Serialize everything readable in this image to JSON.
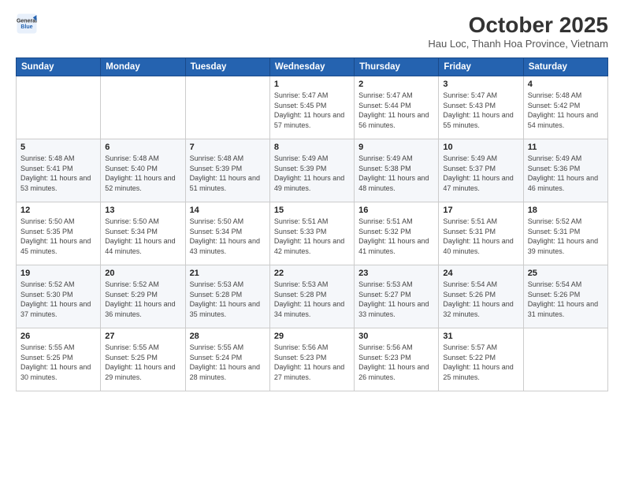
{
  "logo": {
    "line1": "General",
    "line2": "Blue"
  },
  "title": "October 2025",
  "subtitle": "Hau Loc, Thanh Hoa Province, Vietnam",
  "days_of_week": [
    "Sunday",
    "Monday",
    "Tuesday",
    "Wednesday",
    "Thursday",
    "Friday",
    "Saturday"
  ],
  "weeks": [
    [
      {
        "num": "",
        "info": ""
      },
      {
        "num": "",
        "info": ""
      },
      {
        "num": "",
        "info": ""
      },
      {
        "num": "1",
        "info": "Sunrise: 5:47 AM\nSunset: 5:45 PM\nDaylight: 11 hours and 57 minutes."
      },
      {
        "num": "2",
        "info": "Sunrise: 5:47 AM\nSunset: 5:44 PM\nDaylight: 11 hours and 56 minutes."
      },
      {
        "num": "3",
        "info": "Sunrise: 5:47 AM\nSunset: 5:43 PM\nDaylight: 11 hours and 55 minutes."
      },
      {
        "num": "4",
        "info": "Sunrise: 5:48 AM\nSunset: 5:42 PM\nDaylight: 11 hours and 54 minutes."
      }
    ],
    [
      {
        "num": "5",
        "info": "Sunrise: 5:48 AM\nSunset: 5:41 PM\nDaylight: 11 hours and 53 minutes."
      },
      {
        "num": "6",
        "info": "Sunrise: 5:48 AM\nSunset: 5:40 PM\nDaylight: 11 hours and 52 minutes."
      },
      {
        "num": "7",
        "info": "Sunrise: 5:48 AM\nSunset: 5:39 PM\nDaylight: 11 hours and 51 minutes."
      },
      {
        "num": "8",
        "info": "Sunrise: 5:49 AM\nSunset: 5:39 PM\nDaylight: 11 hours and 49 minutes."
      },
      {
        "num": "9",
        "info": "Sunrise: 5:49 AM\nSunset: 5:38 PM\nDaylight: 11 hours and 48 minutes."
      },
      {
        "num": "10",
        "info": "Sunrise: 5:49 AM\nSunset: 5:37 PM\nDaylight: 11 hours and 47 minutes."
      },
      {
        "num": "11",
        "info": "Sunrise: 5:49 AM\nSunset: 5:36 PM\nDaylight: 11 hours and 46 minutes."
      }
    ],
    [
      {
        "num": "12",
        "info": "Sunrise: 5:50 AM\nSunset: 5:35 PM\nDaylight: 11 hours and 45 minutes."
      },
      {
        "num": "13",
        "info": "Sunrise: 5:50 AM\nSunset: 5:34 PM\nDaylight: 11 hours and 44 minutes."
      },
      {
        "num": "14",
        "info": "Sunrise: 5:50 AM\nSunset: 5:34 PM\nDaylight: 11 hours and 43 minutes."
      },
      {
        "num": "15",
        "info": "Sunrise: 5:51 AM\nSunset: 5:33 PM\nDaylight: 11 hours and 42 minutes."
      },
      {
        "num": "16",
        "info": "Sunrise: 5:51 AM\nSunset: 5:32 PM\nDaylight: 11 hours and 41 minutes."
      },
      {
        "num": "17",
        "info": "Sunrise: 5:51 AM\nSunset: 5:31 PM\nDaylight: 11 hours and 40 minutes."
      },
      {
        "num": "18",
        "info": "Sunrise: 5:52 AM\nSunset: 5:31 PM\nDaylight: 11 hours and 39 minutes."
      }
    ],
    [
      {
        "num": "19",
        "info": "Sunrise: 5:52 AM\nSunset: 5:30 PM\nDaylight: 11 hours and 37 minutes."
      },
      {
        "num": "20",
        "info": "Sunrise: 5:52 AM\nSunset: 5:29 PM\nDaylight: 11 hours and 36 minutes."
      },
      {
        "num": "21",
        "info": "Sunrise: 5:53 AM\nSunset: 5:28 PM\nDaylight: 11 hours and 35 minutes."
      },
      {
        "num": "22",
        "info": "Sunrise: 5:53 AM\nSunset: 5:28 PM\nDaylight: 11 hours and 34 minutes."
      },
      {
        "num": "23",
        "info": "Sunrise: 5:53 AM\nSunset: 5:27 PM\nDaylight: 11 hours and 33 minutes."
      },
      {
        "num": "24",
        "info": "Sunrise: 5:54 AM\nSunset: 5:26 PM\nDaylight: 11 hours and 32 minutes."
      },
      {
        "num": "25",
        "info": "Sunrise: 5:54 AM\nSunset: 5:26 PM\nDaylight: 11 hours and 31 minutes."
      }
    ],
    [
      {
        "num": "26",
        "info": "Sunrise: 5:55 AM\nSunset: 5:25 PM\nDaylight: 11 hours and 30 minutes."
      },
      {
        "num": "27",
        "info": "Sunrise: 5:55 AM\nSunset: 5:25 PM\nDaylight: 11 hours and 29 minutes."
      },
      {
        "num": "28",
        "info": "Sunrise: 5:55 AM\nSunset: 5:24 PM\nDaylight: 11 hours and 28 minutes."
      },
      {
        "num": "29",
        "info": "Sunrise: 5:56 AM\nSunset: 5:23 PM\nDaylight: 11 hours and 27 minutes."
      },
      {
        "num": "30",
        "info": "Sunrise: 5:56 AM\nSunset: 5:23 PM\nDaylight: 11 hours and 26 minutes."
      },
      {
        "num": "31",
        "info": "Sunrise: 5:57 AM\nSunset: 5:22 PM\nDaylight: 11 hours and 25 minutes."
      },
      {
        "num": "",
        "info": ""
      }
    ]
  ]
}
